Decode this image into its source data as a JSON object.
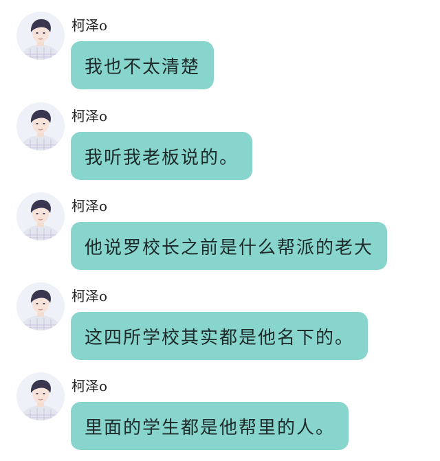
{
  "chat": {
    "messages": [
      {
        "sender": "柯泽o",
        "avatar_icon": "user-avatar-icon",
        "text": "我也不太清楚"
      },
      {
        "sender": "柯泽o",
        "avatar_icon": "user-avatar-icon",
        "text": "我听我老板说的。"
      },
      {
        "sender": "柯泽o",
        "avatar_icon": "user-avatar-icon",
        "text": "他说罗校长之前是什么帮派的老大"
      },
      {
        "sender": "柯泽o",
        "avatar_icon": "user-avatar-icon",
        "text": "这四所学校其实都是他名下的。"
      },
      {
        "sender": "柯泽o",
        "avatar_icon": "user-avatar-icon",
        "text": "里面的学生都是他帮里的人。"
      }
    ]
  },
  "colors": {
    "bubble": "#87d5cc",
    "background": "#ffffff",
    "text": "#1e2a2a"
  }
}
